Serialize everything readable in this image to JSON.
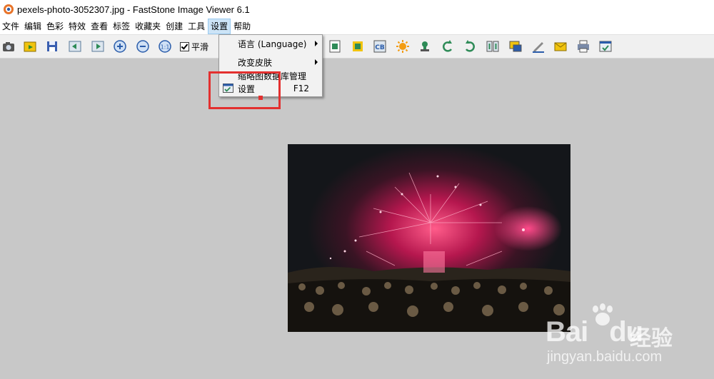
{
  "window": {
    "title": "pexels-photo-3052307.jpg  -  FastStone Image Viewer 6.1"
  },
  "menubar": {
    "items": [
      "文件",
      "编辑",
      "色彩",
      "特效",
      "查看",
      "标签",
      "收藏夹",
      "创建",
      "工具",
      "设置",
      "帮助"
    ],
    "active": "设置"
  },
  "toolbar": {
    "smooth_label": "平滑",
    "smooth_checked": true,
    "buttons": [
      "camera-icon",
      "open-folder-icon",
      "save-icon",
      "prev-icon",
      "next-icon",
      "zoom-in-icon",
      "zoom-out-icon",
      "actual-size-icon",
      "resize-icon",
      "crop-icon",
      "cb-icon",
      "brightness-icon",
      "stamp-icon",
      "rotate-left-icon",
      "rotate-right-icon",
      "compare-icon",
      "slideshow-icon",
      "draw-icon",
      "email-icon",
      "print-icon",
      "settings-icon"
    ]
  },
  "settings_menu": {
    "items": [
      {
        "label": "语言 (Language)",
        "submenu": true
      },
      {
        "label": "改变皮肤",
        "submenu": true
      },
      {
        "label": "缩略图数据库管理",
        "submenu": false
      },
      {
        "label": "设置",
        "shortcut": "F12",
        "icon": "settings-icon"
      }
    ]
  },
  "viewer": {
    "image_description": "concert crowd with fireworks",
    "background": "#c8c8c8"
  },
  "watermark": {
    "brand": "Bai",
    "brand2": "du",
    "cn": "经验",
    "url": "jingyan.baidu.com"
  },
  "annotation": {
    "color": "#e3302f"
  }
}
